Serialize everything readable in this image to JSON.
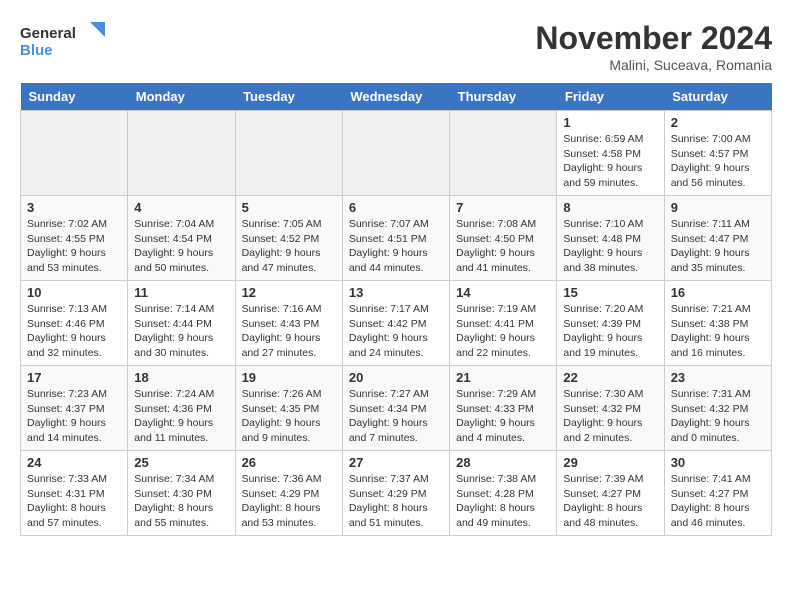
{
  "logo": {
    "line1": "General",
    "line2": "Blue"
  },
  "title": "November 2024",
  "subtitle": "Malini, Suceava, Romania",
  "days_of_week": [
    "Sunday",
    "Monday",
    "Tuesday",
    "Wednesday",
    "Thursday",
    "Friday",
    "Saturday"
  ],
  "weeks": [
    [
      {
        "day": "",
        "info": ""
      },
      {
        "day": "",
        "info": ""
      },
      {
        "day": "",
        "info": ""
      },
      {
        "day": "",
        "info": ""
      },
      {
        "day": "",
        "info": ""
      },
      {
        "day": "1",
        "info": "Sunrise: 6:59 AM\nSunset: 4:58 PM\nDaylight: 9 hours and 59 minutes."
      },
      {
        "day": "2",
        "info": "Sunrise: 7:00 AM\nSunset: 4:57 PM\nDaylight: 9 hours and 56 minutes."
      }
    ],
    [
      {
        "day": "3",
        "info": "Sunrise: 7:02 AM\nSunset: 4:55 PM\nDaylight: 9 hours and 53 minutes."
      },
      {
        "day": "4",
        "info": "Sunrise: 7:04 AM\nSunset: 4:54 PM\nDaylight: 9 hours and 50 minutes."
      },
      {
        "day": "5",
        "info": "Sunrise: 7:05 AM\nSunset: 4:52 PM\nDaylight: 9 hours and 47 minutes."
      },
      {
        "day": "6",
        "info": "Sunrise: 7:07 AM\nSunset: 4:51 PM\nDaylight: 9 hours and 44 minutes."
      },
      {
        "day": "7",
        "info": "Sunrise: 7:08 AM\nSunset: 4:50 PM\nDaylight: 9 hours and 41 minutes."
      },
      {
        "day": "8",
        "info": "Sunrise: 7:10 AM\nSunset: 4:48 PM\nDaylight: 9 hours and 38 minutes."
      },
      {
        "day": "9",
        "info": "Sunrise: 7:11 AM\nSunset: 4:47 PM\nDaylight: 9 hours and 35 minutes."
      }
    ],
    [
      {
        "day": "10",
        "info": "Sunrise: 7:13 AM\nSunset: 4:46 PM\nDaylight: 9 hours and 32 minutes."
      },
      {
        "day": "11",
        "info": "Sunrise: 7:14 AM\nSunset: 4:44 PM\nDaylight: 9 hours and 30 minutes."
      },
      {
        "day": "12",
        "info": "Sunrise: 7:16 AM\nSunset: 4:43 PM\nDaylight: 9 hours and 27 minutes."
      },
      {
        "day": "13",
        "info": "Sunrise: 7:17 AM\nSunset: 4:42 PM\nDaylight: 9 hours and 24 minutes."
      },
      {
        "day": "14",
        "info": "Sunrise: 7:19 AM\nSunset: 4:41 PM\nDaylight: 9 hours and 22 minutes."
      },
      {
        "day": "15",
        "info": "Sunrise: 7:20 AM\nSunset: 4:39 PM\nDaylight: 9 hours and 19 minutes."
      },
      {
        "day": "16",
        "info": "Sunrise: 7:21 AM\nSunset: 4:38 PM\nDaylight: 9 hours and 16 minutes."
      }
    ],
    [
      {
        "day": "17",
        "info": "Sunrise: 7:23 AM\nSunset: 4:37 PM\nDaylight: 9 hours and 14 minutes."
      },
      {
        "day": "18",
        "info": "Sunrise: 7:24 AM\nSunset: 4:36 PM\nDaylight: 9 hours and 11 minutes."
      },
      {
        "day": "19",
        "info": "Sunrise: 7:26 AM\nSunset: 4:35 PM\nDaylight: 9 hours and 9 minutes."
      },
      {
        "day": "20",
        "info": "Sunrise: 7:27 AM\nSunset: 4:34 PM\nDaylight: 9 hours and 7 minutes."
      },
      {
        "day": "21",
        "info": "Sunrise: 7:29 AM\nSunset: 4:33 PM\nDaylight: 9 hours and 4 minutes."
      },
      {
        "day": "22",
        "info": "Sunrise: 7:30 AM\nSunset: 4:32 PM\nDaylight: 9 hours and 2 minutes."
      },
      {
        "day": "23",
        "info": "Sunrise: 7:31 AM\nSunset: 4:32 PM\nDaylight: 9 hours and 0 minutes."
      }
    ],
    [
      {
        "day": "24",
        "info": "Sunrise: 7:33 AM\nSunset: 4:31 PM\nDaylight: 8 hours and 57 minutes."
      },
      {
        "day": "25",
        "info": "Sunrise: 7:34 AM\nSunset: 4:30 PM\nDaylight: 8 hours and 55 minutes."
      },
      {
        "day": "26",
        "info": "Sunrise: 7:36 AM\nSunset: 4:29 PM\nDaylight: 8 hours and 53 minutes."
      },
      {
        "day": "27",
        "info": "Sunrise: 7:37 AM\nSunset: 4:29 PM\nDaylight: 8 hours and 51 minutes."
      },
      {
        "day": "28",
        "info": "Sunrise: 7:38 AM\nSunset: 4:28 PM\nDaylight: 8 hours and 49 minutes."
      },
      {
        "day": "29",
        "info": "Sunrise: 7:39 AM\nSunset: 4:27 PM\nDaylight: 8 hours and 48 minutes."
      },
      {
        "day": "30",
        "info": "Sunrise: 7:41 AM\nSunset: 4:27 PM\nDaylight: 8 hours and 46 minutes."
      }
    ]
  ]
}
